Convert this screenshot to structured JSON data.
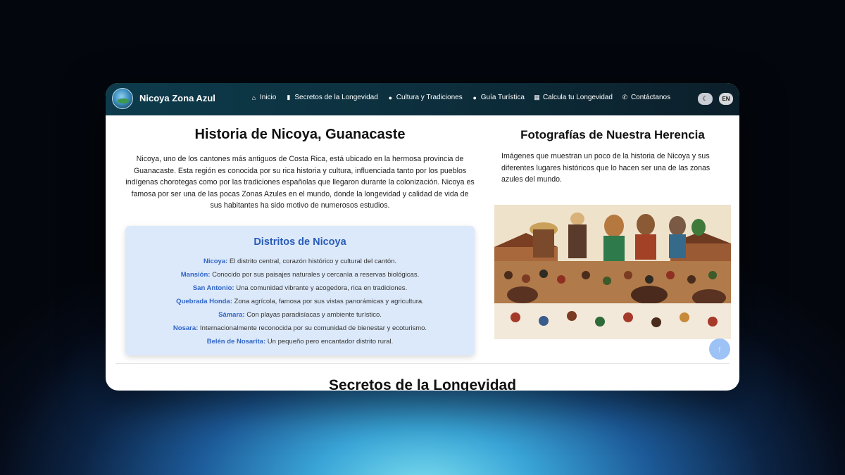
{
  "nav": {
    "brand": "Nicoya Zona Azul",
    "items": [
      {
        "icon": "home-icon",
        "label": "Inicio"
      },
      {
        "icon": "book-icon",
        "label": "Secretos de la Longevidad"
      },
      {
        "icon": "map-marker-icon",
        "label": "Cultura y Tradiciones"
      },
      {
        "icon": "map-marker-icon",
        "label": "Guía Turística"
      },
      {
        "icon": "calculator-icon",
        "label": "Calcula tu Longevidad"
      },
      {
        "icon": "phone-icon",
        "label": "Contáctanos"
      }
    ],
    "lang_label": "EN"
  },
  "history": {
    "title": "Historia de Nicoya, Guanacaste",
    "text": "Nicoya, uno de los cantones más antiguos de Costa Rica, está ubicado en la hermosa provincia de Guanacaste. Esta región es conocida por su rica historia y cultura, influenciada tanto por los pueblos indígenas chorotegas como por las tradiciones españolas que llegaron durante la colonización. Nicoya es famosa por ser una de las pocas Zonas Azules en el mundo, donde la longevidad y calidad de vida de sus habitantes ha sido motivo de numerosos estudios."
  },
  "districts": {
    "title": "Distritos de Nicoya",
    "items": [
      {
        "name": "Nicoya:",
        "desc": " El distrito central, corazón histórico y cultural del cantón."
      },
      {
        "name": "Mansión:",
        "desc": " Conocido por sus paisajes naturales y cercanía a reservas biológicas."
      },
      {
        "name": "San Antonio:",
        "desc": " Una comunidad vibrante y acogedora, rica en tradiciones."
      },
      {
        "name": "Quebrada Honda:",
        "desc": " Zona agrícola, famosa por sus vistas panorámicas y agricultura."
      },
      {
        "name": "Sámara:",
        "desc": " Con playas paradisíacas y ambiente turístico."
      },
      {
        "name": "Nosara:",
        "desc": " Internacionalmente reconocida por su comunidad de bienestar y ecoturismo."
      },
      {
        "name": "Belén de Nosarita:",
        "desc": " Un pequeño pero encantador distrito rural."
      }
    ]
  },
  "gallery": {
    "title": "Fotografías de Nuestra Herencia",
    "text": "Imágenes que muestran un poco de la historia de Nicoya y sus diferentes lugares históricos que lo hacen ser una de las zonas azules del mundo."
  },
  "next_section_title": "Secretos de la Longevidad",
  "colors": {
    "accent": "#2f64c7",
    "nav_bg": "#0d3b4b",
    "card_bg": "#dce9fa"
  }
}
